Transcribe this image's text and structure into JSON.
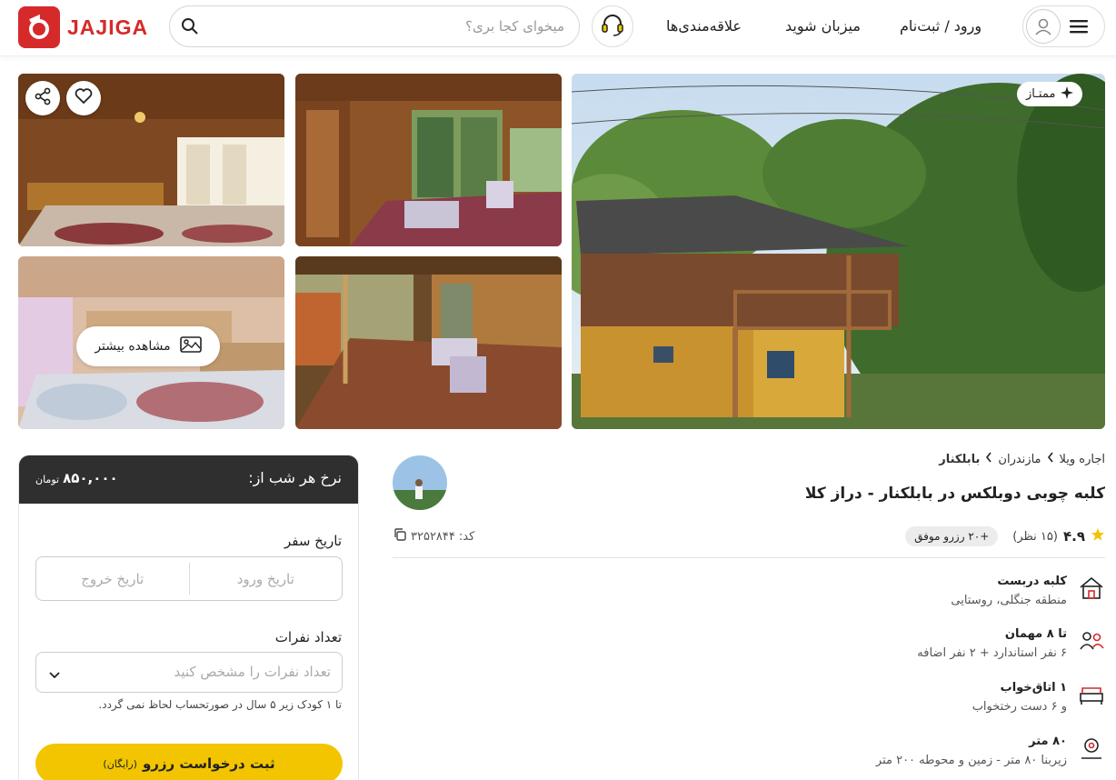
{
  "header": {
    "logo_text": "JAJIGA",
    "search_placeholder": "میخوای کجا بری؟",
    "nav": {
      "favorites": "علاقه‌مندی‌ها",
      "host": "میزبان شوید",
      "login": "ورود / ثبت‌نام"
    }
  },
  "gallery": {
    "badge": "ممتـاز",
    "more_label": "مشاهده بیشتر"
  },
  "booking": {
    "rate_label": "نرخ هر شب از:",
    "price": "۸۵۰,۰۰۰",
    "currency": "تومان",
    "date_label": "تاریخ سفر",
    "checkin_placeholder": "تاریخ ورود",
    "checkout_placeholder": "تاریخ خروج",
    "guests_label": "تعداد نفرات",
    "guests_placeholder": "تعداد نفرات را مشخص کنید",
    "child_note": "تا ۱ کودک زیر ۵ سال در صورتحساب لحاظ نمی گردد.",
    "reserve_label": "ثبت درخواست رزرو",
    "reserve_note": "(رایگان)"
  },
  "listing": {
    "breadcrumbs": [
      "اجاره ویلا",
      "مازندران",
      "بابلکنار"
    ],
    "title": "کلبه چوبی دوبلکس در بابلکنار - دراز کلا",
    "rating": "۴.۹",
    "reviews": "(۱۵ نظر)",
    "successful_bookings": "+۲۰ رزرو موفق",
    "code_label": "کد:",
    "code_value": "۳۲۵۲۸۴۴",
    "features": [
      {
        "icon": "house-icon",
        "title": "کلبه دربست",
        "sub": "منطقه جنگلی، روستایی"
      },
      {
        "icon": "guests-icon",
        "title": "تا ۸ مهمان",
        "sub": "۶ نفر استاندارد + ۲ نفر اضافه"
      },
      {
        "icon": "bed-icon",
        "title": "۱ اتاق‌خواب",
        "sub": "و ۶ دست رختخواب"
      },
      {
        "icon": "area-icon",
        "title": "۸۰ متر",
        "sub": "زیربنا ۸۰ متر - زمین و محوطه ۲۰۰ متر"
      }
    ]
  },
  "colors": {
    "brand": "#d62a2a",
    "accent": "#f2c500",
    "dark": "#2f2f2f"
  }
}
